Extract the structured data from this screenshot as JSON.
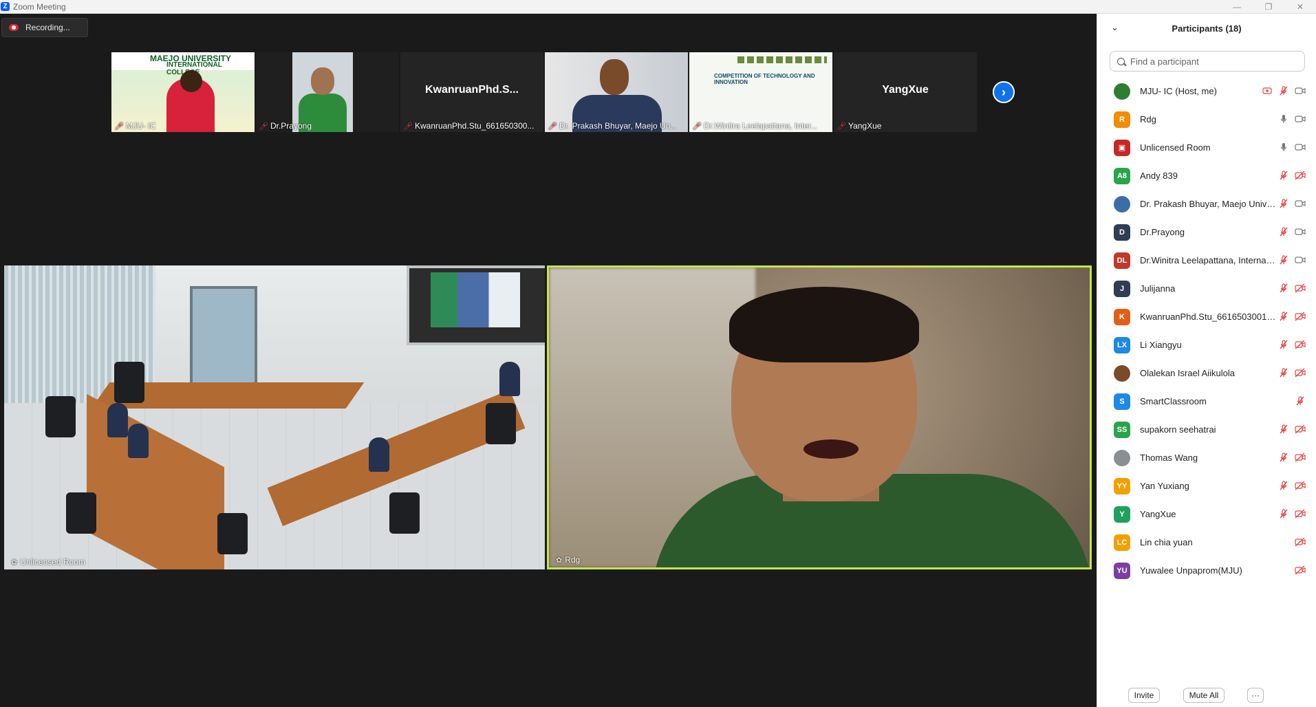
{
  "window": {
    "title": "Zoom Meeting",
    "logo_letter": "Z"
  },
  "recording": {
    "label": "Recording..."
  },
  "thumbnails": [
    {
      "id": "mju",
      "name": "MJU- IC",
      "slide_title": "MAEJO UNIVERSITY",
      "slide_sub": "INTERNATIONAL COLLEGE"
    },
    {
      "id": "prayong",
      "name": "Dr.Prayong"
    },
    {
      "id": "kwanruan",
      "name": "KwanruanPhd.Stu_661650300...",
      "display_text": "KwanruanPhd.S..."
    },
    {
      "id": "prakash",
      "name": "Dr. Prakash Bhuyar, Maejo Un..."
    },
    {
      "id": "winitra",
      "name": "Dr.Winitra Leelapattana, Inter...",
      "slide_text": "COMPETITION OF TECHNOLOGY AND INNOVATION"
    },
    {
      "id": "yangxue",
      "name": "YangXue",
      "display_text": "YangXue"
    }
  ],
  "tiles": {
    "room": {
      "name": "Unlicensed Room"
    },
    "rdg": {
      "name": "Rdg"
    }
  },
  "panel": {
    "title": "Participants (18)",
    "search_placeholder": "Find a participant",
    "participants": [
      {
        "name": "MJU- IC (Host, me)",
        "initials": "",
        "color": "#2e7d32",
        "photo": true,
        "share": true,
        "mic": "off",
        "video": "on"
      },
      {
        "name": "Rdg",
        "initials": "R",
        "color": "#f28c00",
        "mic": "on",
        "video": "on"
      },
      {
        "name": "Unlicensed Room",
        "initials": "",
        "color": "#c62828",
        "icon": true,
        "mic": "on",
        "video": "on"
      },
      {
        "name": "Andy 839",
        "initials": "A8",
        "color": "#2aa34a",
        "mic": "off",
        "video": "off"
      },
      {
        "name": "Dr. Prakash Bhuyar, Maejo Unive...",
        "initials": "",
        "color": "#3b6ea8",
        "photo": true,
        "mic": "off",
        "video": "on"
      },
      {
        "name": "Dr.Prayong",
        "initials": "D",
        "color": "#2f3e52",
        "mic": "off",
        "video": "on"
      },
      {
        "name": "Dr.Winitra Leelapattana, Internati...",
        "initials": "DL",
        "color": "#c0392b",
        "mic": "off",
        "video": "on"
      },
      {
        "name": "Julijanna",
        "initials": "J",
        "color": "#2f3e52",
        "mic": "off",
        "video": "off"
      },
      {
        "name": "KwanruanPhd.Stu_6616503001_D...",
        "initials": "K",
        "color": "#e0601a",
        "mic": "off",
        "video": "off"
      },
      {
        "name": "Li Xiangyu",
        "initials": "LX",
        "color": "#1e88e5",
        "mic": "off",
        "video": "off"
      },
      {
        "name": "Olalekan Israel Aiikulola",
        "initials": "",
        "color": "#7b4a2a",
        "photo": true,
        "mic": "off",
        "video": "off"
      },
      {
        "name": "SmartClassroom",
        "initials": "S",
        "color": "#1e88e5",
        "mic": "off",
        "video": "none"
      },
      {
        "name": "supakorn seehatrai",
        "initials": "SS",
        "color": "#2aa34a",
        "mic": "off",
        "video": "off"
      },
      {
        "name": "Thomas Wang",
        "initials": "",
        "color": "#8a8f94",
        "photo": true,
        "mic": "off",
        "video": "off"
      },
      {
        "name": "Yan Yuxiang",
        "initials": "YY",
        "color": "#f2a000",
        "mic": "off",
        "video": "off"
      },
      {
        "name": "YangXue",
        "initials": "Y",
        "color": "#20a060",
        "mic": "off",
        "video": "off"
      },
      {
        "name": "Lin chia yuan",
        "initials": "LC",
        "color": "#f2a000",
        "mic": "none",
        "video": "off"
      },
      {
        "name": "Yuwalee Unpaprom(MJU)",
        "initials": "YU",
        "color": "#7b3fa0",
        "mic": "none",
        "video": "off"
      }
    ],
    "footer": {
      "invite": "Invite",
      "mute_all": "Mute All",
      "more": "···"
    }
  },
  "colors": {
    "accent": "#0e72ed",
    "active_speaker": "#c3e64a",
    "muted": "#e64545"
  }
}
